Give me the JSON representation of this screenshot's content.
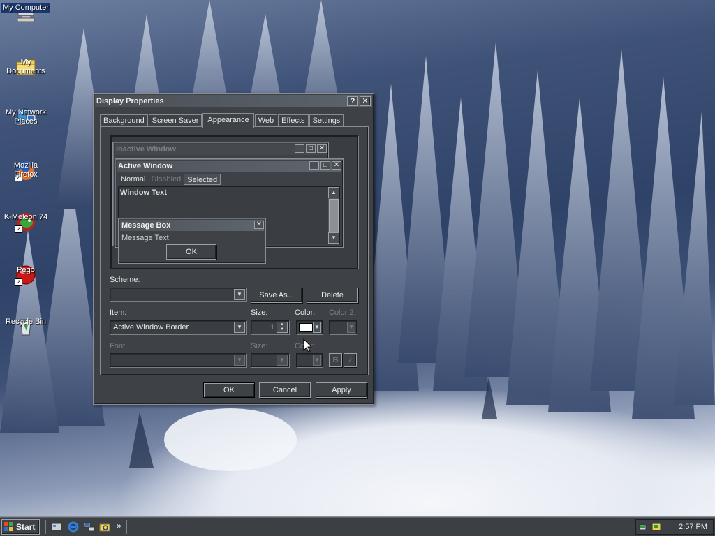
{
  "desktop": {
    "icons": [
      {
        "label": "My Computer",
        "icon": "computer-icon"
      },
      {
        "label": "My Documents",
        "icon": "folder-icon"
      },
      {
        "label": "My Network Places",
        "icon": "network-icon"
      },
      {
        "label": "Mozilla Firefox",
        "icon": "firefox-icon"
      },
      {
        "label": "K-Meleon 74",
        "icon": "kmeleon-icon"
      },
      {
        "label": "Pego",
        "icon": "pego-icon"
      },
      {
        "label": "Recycle Bin",
        "icon": "recycle-bin-icon"
      }
    ]
  },
  "dialog": {
    "title": "Display Properties",
    "help_glyph": "?",
    "close_glyph": "✕",
    "tabs": [
      "Background",
      "Screen Saver",
      "Appearance",
      "Web",
      "Effects",
      "Settings"
    ],
    "active_tab": "Appearance",
    "preview": {
      "inactive_title": "Inactive Window",
      "active_title": "Active Window",
      "menu": [
        "Normal",
        "Disabled",
        "Selected"
      ],
      "window_text": "Window Text",
      "msgbox_title": "Message Box",
      "msgbox_text": "Message Text",
      "msgbox_ok": "OK"
    },
    "scheme": {
      "label": "Scheme:",
      "value": "",
      "save_as": "Save As...",
      "delete": "Delete"
    },
    "item": {
      "label": "Item:",
      "value": "Active Window Border",
      "size_label": "Size:",
      "size_value": "1",
      "color_label": "Color:",
      "color_value": "#ffffff",
      "color2_label": "Color 2:"
    },
    "font": {
      "label": "Font:",
      "value": "",
      "size_label": "Size:",
      "color_label": "Color:",
      "bold": "B",
      "italic": "/"
    },
    "buttons": {
      "ok": "OK",
      "cancel": "Cancel",
      "apply": "Apply"
    }
  },
  "taskbar": {
    "start_label": "Start",
    "chevron": "»",
    "clock": "2:57 PM"
  }
}
